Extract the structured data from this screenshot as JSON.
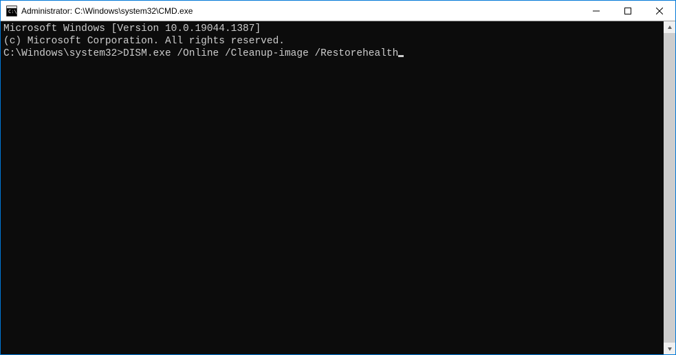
{
  "titlebar": {
    "title": "Administrator: C:\\Windows\\system32\\CMD.exe"
  },
  "terminal": {
    "line1": "Microsoft Windows [Version 10.0.19044.1387]",
    "line2": "(c) Microsoft Corporation. All rights reserved.",
    "blank": "",
    "prompt": "C:\\Windows\\system32>",
    "command": "DISM.exe /Online /Cleanup-image /Restorehealth"
  }
}
